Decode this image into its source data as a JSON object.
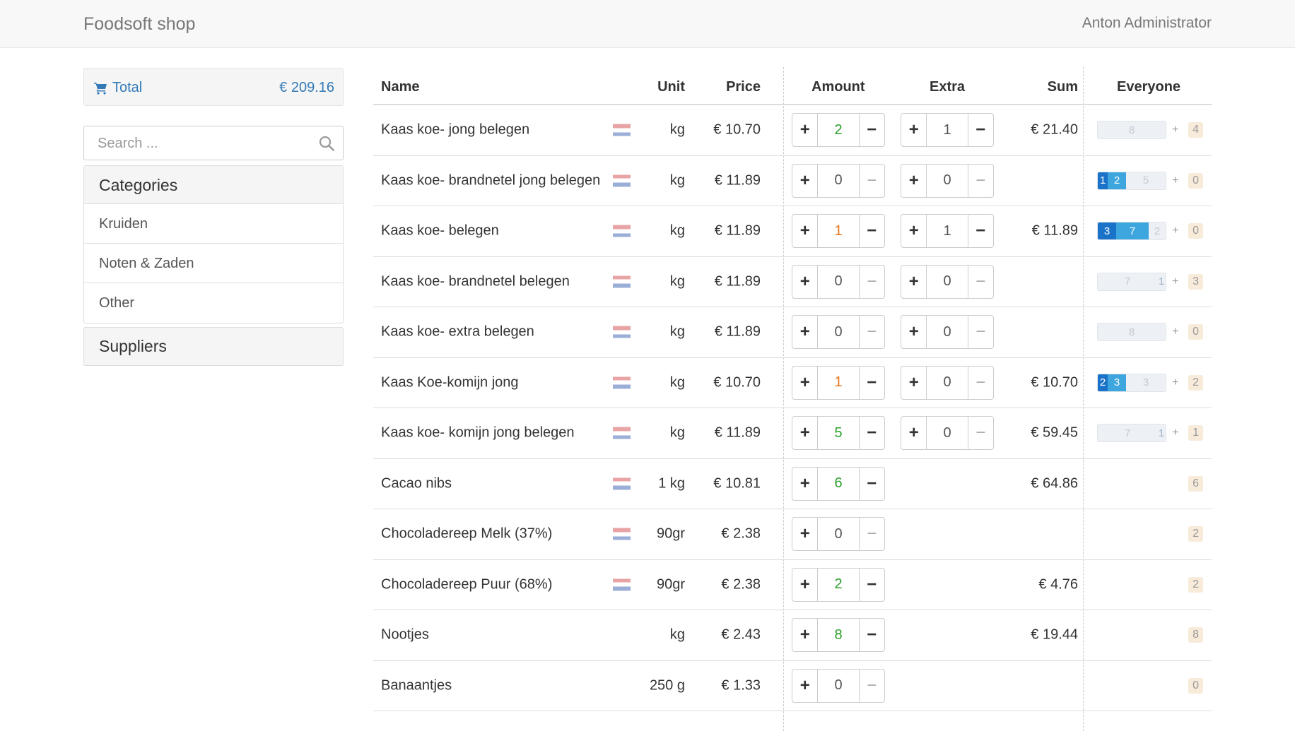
{
  "brand": "Foodsoft shop",
  "user": "Anton Administrator",
  "sidebar": {
    "total_label": "Total",
    "total_amount": "€ 209.16",
    "search_placeholder": "Search ...",
    "categories_title": "Categories",
    "categories": [
      "Kruiden",
      "Noten & Zaden",
      "Other"
    ],
    "suppliers_title": "Suppliers"
  },
  "colors": {
    "accent": "#337ab7",
    "flag_red": "#e8a4a4",
    "flag_blue": "#9aaed8",
    "progress_dark": "#1a73c8",
    "progress_light": "#3ea6de"
  },
  "table": {
    "headers": {
      "name": "Name",
      "unit": "Unit",
      "price": "Price",
      "amount": "Amount",
      "extra": "Extra",
      "sum": "Sum",
      "everyone": "Everyone"
    },
    "rows": [
      {
        "name": "Kaas koe- jong belegen",
        "flag": true,
        "unit": "kg",
        "price": "€ 10.70",
        "amount": "2",
        "extra": "1",
        "sum": "€ 21.40",
        "progress": [
          "",
          "",
          "8"
        ],
        "plus": "+",
        "badge": "4"
      },
      {
        "name": "Kaas koe- brandnetel jong belegen",
        "flag": true,
        "unit": "kg",
        "price": "€ 11.89",
        "amount": "0",
        "extra": "0",
        "sum": "",
        "progress": [
          "1",
          "2",
          "5"
        ],
        "plus": "+",
        "badge": "0"
      },
      {
        "name": "Kaas koe- belegen",
        "flag": true,
        "unit": "kg",
        "price": "€ 11.89",
        "amount": "1",
        "extra": "1",
        "sum": "€ 11.89",
        "progress": [
          "3",
          "7",
          "2"
        ],
        "plus": "+",
        "badge": "0"
      },
      {
        "name": "Kaas koe- brandnetel belegen",
        "flag": true,
        "unit": "kg",
        "price": "€ 11.89",
        "amount": "0",
        "extra": "0",
        "sum": "",
        "progress": [
          "",
          "",
          "7",
          "1"
        ],
        "plus": "+",
        "badge": "3"
      },
      {
        "name": "Kaas koe- extra belegen",
        "flag": true,
        "unit": "kg",
        "price": "€ 11.89",
        "amount": "0",
        "extra": "0",
        "sum": "",
        "progress": [
          "",
          "",
          "8"
        ],
        "plus": "+",
        "badge": "0"
      },
      {
        "name": "Kaas Koe-komijn jong",
        "flag": true,
        "unit": "kg",
        "price": "€ 10.70",
        "amount": "1",
        "extra": "0",
        "sum": "€ 10.70",
        "progress": [
          "2",
          "3",
          "3"
        ],
        "plus": "+",
        "badge": "2"
      },
      {
        "name": "Kaas koe- komijn jong belegen",
        "flag": true,
        "unit": "kg",
        "price": "€ 11.89",
        "amount": "5",
        "extra": "0",
        "sum": "€ 59.45",
        "progress": [
          "",
          "",
          "7",
          "1"
        ],
        "plus": "+",
        "badge": "1"
      },
      {
        "name": "Cacao nibs",
        "flag": true,
        "unit": "1 kg",
        "price": "€ 10.81",
        "amount": "6",
        "extra": null,
        "sum": "€ 64.86",
        "progress": null,
        "plus": "",
        "badge": "6"
      },
      {
        "name": "Chocoladereep Melk (37%)",
        "flag": true,
        "unit": "90gr",
        "price": "€ 2.38",
        "amount": "0",
        "extra": null,
        "sum": "",
        "progress": null,
        "plus": "",
        "badge": "2"
      },
      {
        "name": "Chocoladereep Puur (68%)",
        "flag": true,
        "unit": "90gr",
        "price": "€ 2.38",
        "amount": "2",
        "extra": null,
        "sum": "€ 4.76",
        "progress": null,
        "plus": "",
        "badge": "2"
      },
      {
        "name": "Nootjes",
        "flag": false,
        "unit": "kg",
        "price": "€ 2.43",
        "amount": "8",
        "extra": null,
        "sum": "€ 19.44",
        "progress": null,
        "plus": "",
        "badge": "8"
      },
      {
        "name": "Banaantjes",
        "flag": false,
        "unit": "250 g",
        "price": "€ 1.33",
        "amount": "0",
        "extra": null,
        "sum": "",
        "progress": null,
        "plus": "",
        "badge": "0"
      }
    ]
  }
}
